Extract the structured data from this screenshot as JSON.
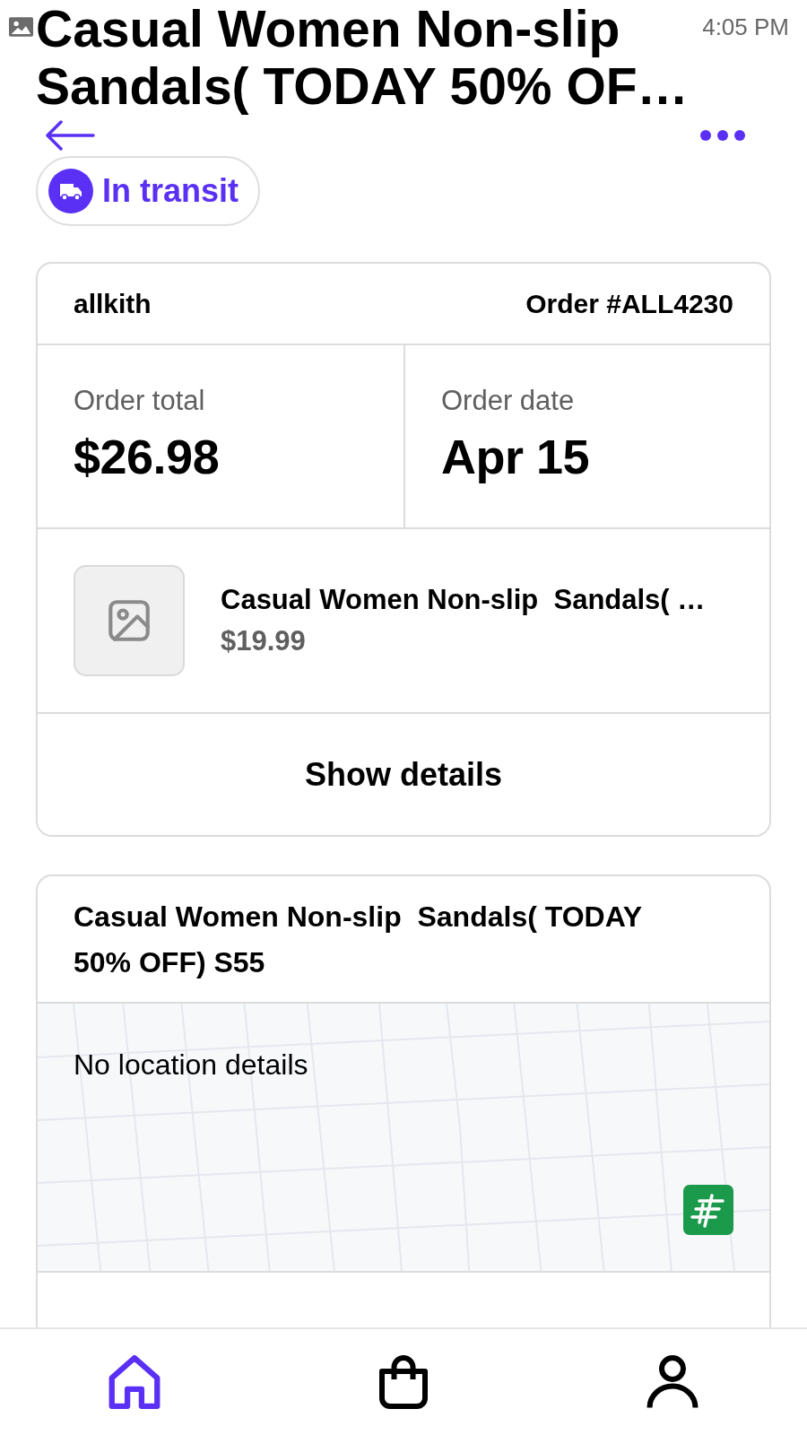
{
  "status_bar": {
    "time": "4:05 PM"
  },
  "header": {
    "title": "Casual Women Non-slip Sandals( TODAY 50% OF…"
  },
  "status_badge": {
    "label": "In transit"
  },
  "order_card": {
    "store": "allkith",
    "order_number": "Order #ALL4230",
    "stats": [
      {
        "label": "Order total",
        "value": "$26.98"
      },
      {
        "label": "Order date",
        "value": "Apr 15"
      }
    ],
    "items": [
      {
        "title": "Casual Women Non-slip  Sandals( …",
        "price": "$19.99"
      }
    ],
    "details_button": "Show details"
  },
  "tracking_card": {
    "title": "Casual Women Non-slip  Sandals( TODAY 50% OFF) S55",
    "location_message": "No location details"
  },
  "bottom_nav": [
    {
      "kind": "home",
      "selected": true
    },
    {
      "kind": "bag",
      "selected": false
    },
    {
      "kind": "account",
      "selected": false
    }
  ]
}
